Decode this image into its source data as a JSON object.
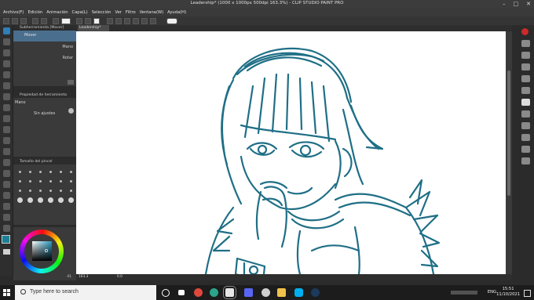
{
  "window": {
    "title": "Leadership* (1000 x 1000px 500dpi 163.3%) - CLIP STUDIO PAINT PRO",
    "controls": [
      "–",
      "□",
      "✕"
    ]
  },
  "menu": [
    "Archivo(F)",
    "Edición",
    "Animación",
    "Capa(L)",
    "Selección",
    "Ver",
    "Filtro",
    "Ventana(W)",
    "Ayuda(H)"
  ],
  "document_tab": "Leadership*",
  "sub_tool": {
    "header": "Subherramienta [Mover]",
    "items": [
      {
        "label": "Mover",
        "right": ""
      },
      {
        "label": "",
        "right": "Mano"
      },
      {
        "label": "",
        "right": "Rotar"
      }
    ]
  },
  "tool_property": {
    "header": "Propiedad de herramienta",
    "tool_name": "Mano",
    "settings_label": "Sin ajustes"
  },
  "brush_size": {
    "header": "Tamaño del pincel"
  },
  "status": {
    "zoom": "163.3",
    "coords": "0.0"
  },
  "color": {
    "main": "#1d7f97",
    "sub": "#ffffff",
    "ring_marker": "#3a8ea8",
    "value": "41"
  },
  "taskbar": {
    "search_placeholder": "Type here to search",
    "language": "ENG",
    "time": "15:51",
    "date": "11/10/2021"
  },
  "sketch": {
    "stroke_color": "#1f6f86"
  }
}
